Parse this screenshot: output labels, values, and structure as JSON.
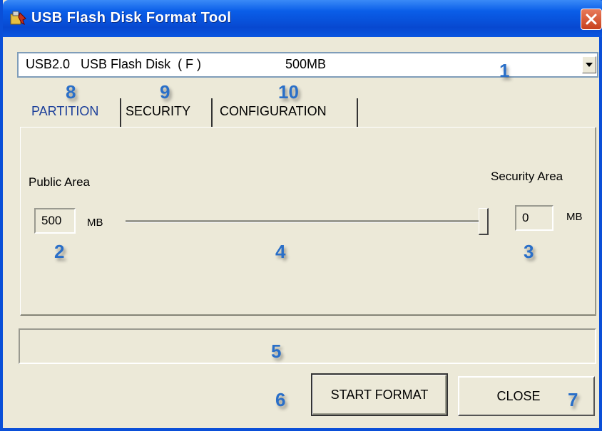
{
  "window": {
    "title": "USB Flash Disk Format Tool"
  },
  "device_select": {
    "device": "USB2.0   USB Flash Disk  ( F )",
    "size": "500MB"
  },
  "callouts": [
    "1",
    "2",
    "3",
    "4",
    "5",
    "6",
    "7",
    "8",
    "9",
    "10"
  ],
  "tabs": [
    {
      "label": "PARTITION",
      "active": true
    },
    {
      "label": "SECURITY",
      "active": false
    },
    {
      "label": "CONFIGURATION",
      "active": false
    }
  ],
  "partition": {
    "public_area_label": "Public Area",
    "security_area_label": "Security Area",
    "public_value": "500",
    "security_value": "0",
    "unit": "MB",
    "slider_value_mb": 500,
    "slider_max_mb": 500
  },
  "buttons": {
    "start_format": "START FORMAT",
    "close": "CLOSE"
  },
  "colors": {
    "titlebar": "#0a5ee8",
    "callout": "#2a6fc8",
    "active_tab": "#1c3f9a"
  },
  "icons": {
    "app": "usb-tool-icon",
    "close": "close-icon",
    "dropdown": "chevron-down-icon"
  }
}
